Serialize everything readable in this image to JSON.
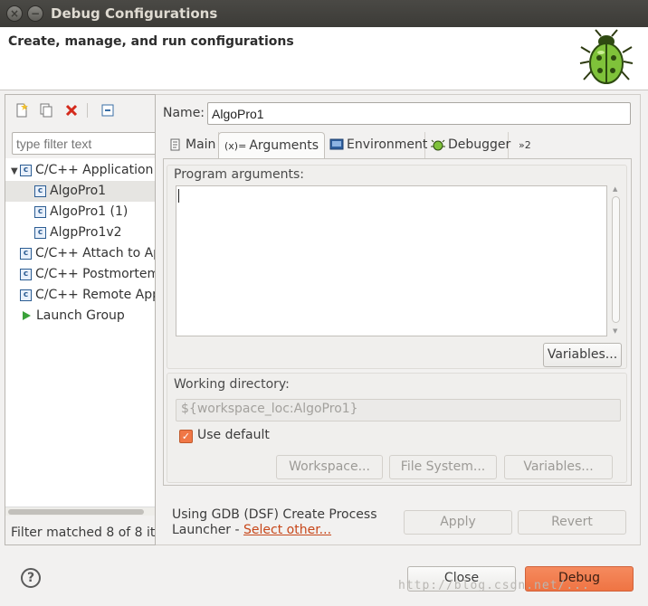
{
  "window": {
    "title": "Debug Configurations"
  },
  "banner": {
    "text": "Create, manage, and run configurations"
  },
  "left": {
    "filter_placeholder": "type filter text",
    "tree": [
      {
        "label": "C/C++ Application",
        "level": 0,
        "expanded": true,
        "icon": "c-config-icon"
      },
      {
        "label": "AlgoPro1",
        "level": 1,
        "selected": true,
        "icon": "c-config-icon"
      },
      {
        "label": "AlgoPro1 (1)",
        "level": 1,
        "icon": "c-config-icon"
      },
      {
        "label": "AlgpPro1v2",
        "level": 1,
        "icon": "c-config-icon"
      },
      {
        "label": "C/C++ Attach to Ap",
        "level": 0,
        "icon": "c-config-icon"
      },
      {
        "label": "C/C++ Postmortem",
        "level": 0,
        "icon": "c-config-icon"
      },
      {
        "label": "C/C++ Remote App",
        "level": 0,
        "icon": "c-config-icon"
      },
      {
        "label": "Launch Group",
        "level": 0,
        "icon": "launch-group-icon"
      }
    ],
    "status": "Filter matched 8 of 8 ite"
  },
  "right": {
    "name_label": "Name:",
    "name_value": "AlgoPro1",
    "tabs": {
      "main": "Main",
      "arguments": "Arguments",
      "environment": "Environment",
      "debugger": "Debugger",
      "overflow": "»2"
    },
    "program_args_label": "Program arguments:",
    "variables_label": "Variables...",
    "working_dir_label": "Working directory:",
    "working_dir_value": "${workspace_loc:AlgoPro1}",
    "use_default_label": "Use default",
    "use_default_checked": true,
    "workspace_label": "Workspace...",
    "filesystem_label": "File System...",
    "variables2_label": "Variables...",
    "launcher_line1": "Using GDB (DSF) Create Process",
    "launcher_line2": "Launcher - ",
    "select_other": "Select other...",
    "apply_label": "Apply",
    "revert_label": "Revert"
  },
  "footer": {
    "help": "?",
    "close_label": "Close",
    "debug_label": "Debug",
    "watermark": "http://blog.csdn.net/..."
  },
  "colors": {
    "accent": "#f07746",
    "titlebar": "#3c3b37",
    "link": "#c7471a"
  }
}
